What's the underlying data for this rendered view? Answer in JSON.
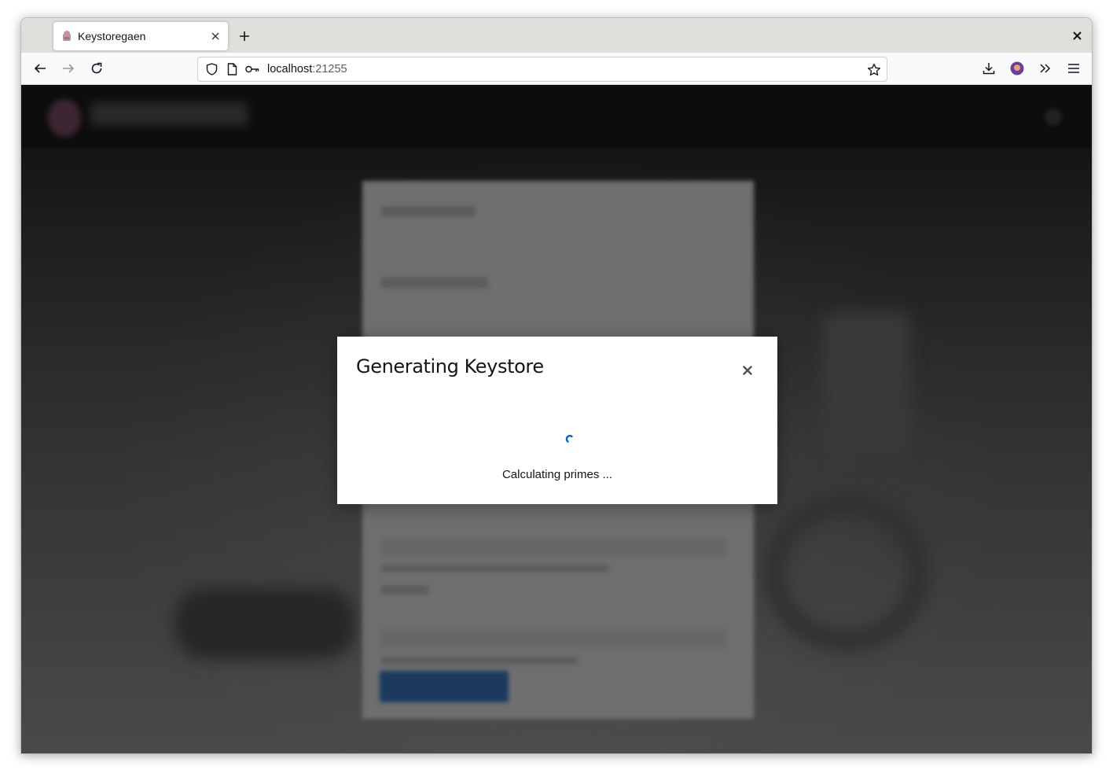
{
  "browser": {
    "tab_title": "Keystoregaen",
    "url_host": "localhost",
    "url_port": ":21255",
    "icons": [
      "tab-favicon",
      "close-icon",
      "plus-icon",
      "back-icon",
      "forward-icon",
      "reload-icon",
      "shield-icon",
      "page-icon",
      "key-icon",
      "star-icon",
      "download-icon",
      "avatar",
      "overflow-icon",
      "menu-icon"
    ]
  },
  "modal": {
    "title": "Generating Keystore",
    "message": "Calculating primes ...",
    "accent_color": "#0066cc"
  }
}
